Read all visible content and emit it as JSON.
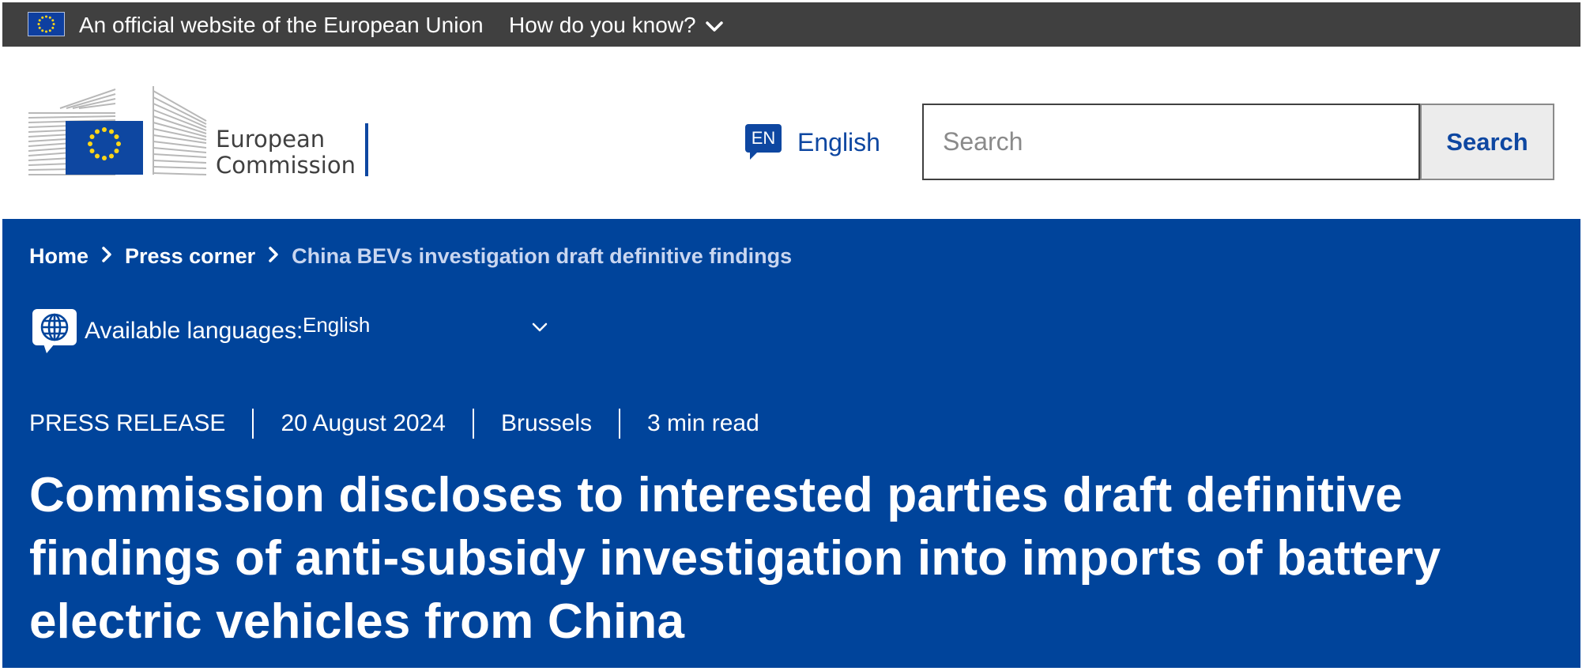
{
  "topbar": {
    "official_text": "An official website of the European Union",
    "how_do_you_know": "How do you know?"
  },
  "header": {
    "logo_line1": "European",
    "logo_line2": "Commission",
    "language": {
      "code": "EN",
      "name": "English"
    },
    "search": {
      "placeholder": "Search",
      "button_label": "Search"
    }
  },
  "breadcrumb": {
    "items": [
      "Home",
      "Press corner"
    ],
    "current": "China BEVs investigation draft definitive findings"
  },
  "available_languages": {
    "label": "Available languages:",
    "selected": "English"
  },
  "meta": {
    "type": "PRESS RELEASE",
    "date": "20 August 2024",
    "location": "Brussels",
    "read_time": "3 min read"
  },
  "headline": "Commission discloses to interested parties draft definitive findings of anti-subsidy investigation into imports of battery electric vehicles from China",
  "colors": {
    "topbar_bg": "#404040",
    "brand_blue": "#0e47a1",
    "hero_blue": "#00449b",
    "eu_yellow": "#ffd617"
  }
}
